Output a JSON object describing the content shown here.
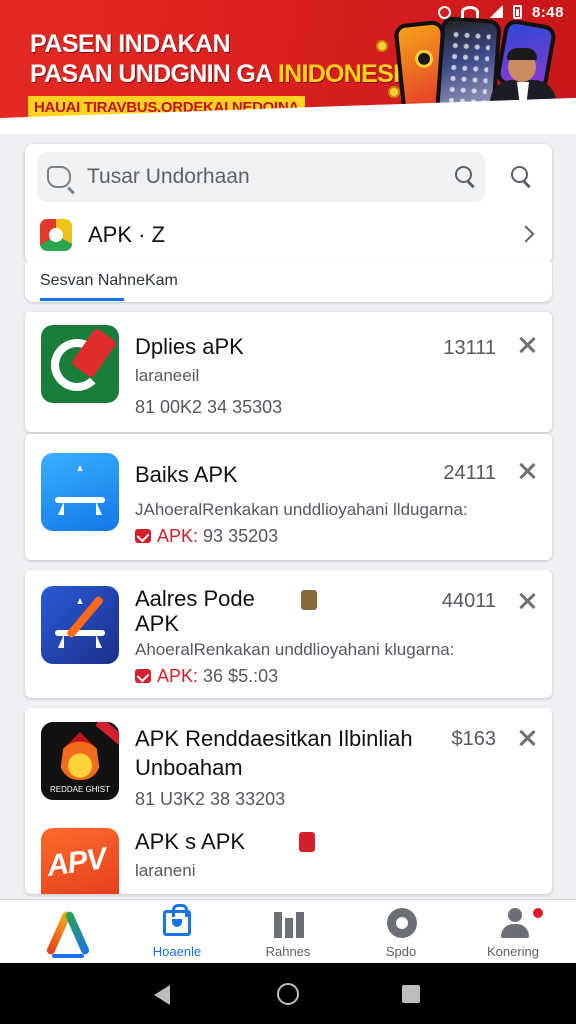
{
  "status_bar": {
    "time": "8:48"
  },
  "banner": {
    "line1": "PASEN INDAKAN",
    "line2_main": "PASAN UNDGNIN GA ",
    "line2_highlight": "INIDONESI",
    "strip": "HAUAI TIRAVBUS.ORDEKAI NEDOINA",
    "colors": {
      "background": "#e42a22",
      "highlight": "#ffd21f"
    }
  },
  "search": {
    "placeholder": "Tusar Undorhaan",
    "apk_row_label": "APK · Z"
  },
  "section": {
    "title": "Sesvan NahneKam"
  },
  "apps": [
    {
      "name": "Dplies aPK",
      "sub": "laraneeil",
      "meta": "81 00K2 34 35303",
      "count": "13111"
    },
    {
      "name": "Baiks APK",
      "sub": "JAhoeralRenkakan unddlioyahani lldugarna:",
      "meta_red": "APK:",
      "meta": "93 35203",
      "count": "24111"
    },
    {
      "name_line1": "Aalres Pode",
      "name_line2": "APK",
      "sub": "AhoeralRenkakan unddlioyahani klugarna:",
      "meta_red": "APK:",
      "meta": "36 $5.:03",
      "count": "44011"
    },
    {
      "name_line1": "APK Renddaesitkan Ilbinliah",
      "name_line2": "Unboaham",
      "meta": "81 U3K2 38 33203",
      "count": "$163",
      "icon_text": "REDDAE GHIST"
    },
    {
      "name": "APK s APK",
      "sub": "laraneni",
      "icon_text": "APV"
    }
  ],
  "bottom_nav": {
    "items": [
      {
        "label": "",
        "icon": "app-logo-icon"
      },
      {
        "label": "Hoaenle",
        "icon": "shopping-bag-icon"
      },
      {
        "label": "Rahnes",
        "icon": "bar-chart-icon"
      },
      {
        "label": "Spdo",
        "icon": "disc-icon"
      },
      {
        "label": "Konering",
        "icon": "user-icon"
      }
    ],
    "active_color": "#1a73e8"
  }
}
